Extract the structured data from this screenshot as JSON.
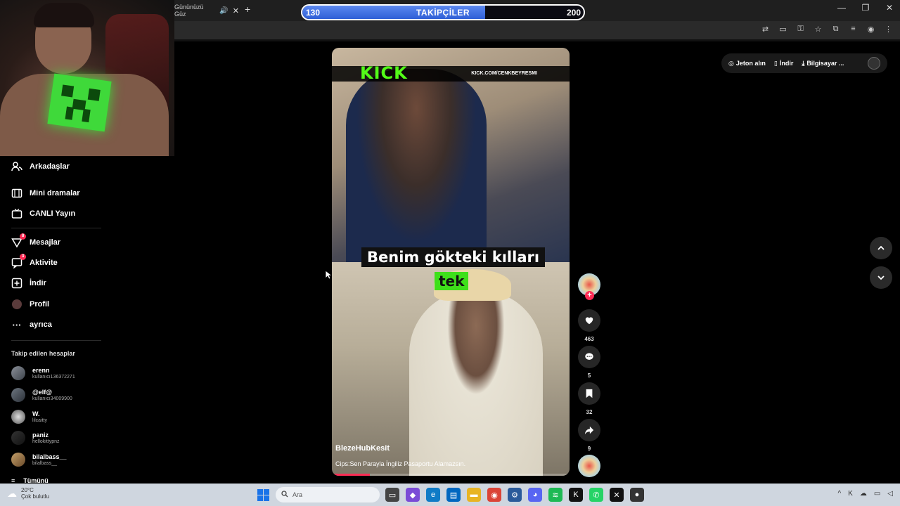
{
  "browser": {
    "tab_title": "Gününüzü Güz",
    "close_tab": "✕",
    "new_tab": "+",
    "window_controls": [
      "—",
      "❐",
      "✕"
    ],
    "toolbar_icons": [
      "translate-icon",
      "screen-icon",
      "key-icon",
      "star-icon",
      "extensions-icon",
      "media-icon",
      "profile-icon",
      "menu-icon"
    ]
  },
  "overlay": {
    "current": "130",
    "label": "TAKİPÇİLER",
    "goal": "200",
    "progress_fraction": 0.65
  },
  "sidebar": {
    "items": [
      {
        "label": "Arkadaşlar",
        "icon": "friends-icon",
        "glyph": "👥"
      },
      {
        "label": "Mini dramalar",
        "icon": "film-icon",
        "glyph": "▦"
      },
      {
        "label": "CANLI Yayın",
        "icon": "live-icon",
        "glyph": "▣"
      },
      {
        "label": "Mesajlar",
        "icon": "messages-icon",
        "glyph": "▽",
        "badge": "8"
      },
      {
        "label": "Aktivite",
        "icon": "activity-icon",
        "glyph": "▢",
        "badge": "3"
      },
      {
        "label": "İndir",
        "icon": "download-icon",
        "glyph": "⊞"
      },
      {
        "label": "Profil",
        "icon": "profile-icon",
        "glyph": "●"
      },
      {
        "label": "ayrıca",
        "icon": "more-icon",
        "glyph": "···"
      }
    ],
    "following_header": "Takip edilen hesaplar",
    "accounts": [
      {
        "name": "erenn",
        "handle": "kullanıcı136372271"
      },
      {
        "name": "@elf@",
        "handle": "kullanıcı34009900"
      },
      {
        "name": "W.",
        "handle": "lilcaitty"
      },
      {
        "name": "paniz",
        "handle": "hellokittypnz"
      },
      {
        "name": "bilalbass__",
        "handle": "bilalbass__"
      }
    ],
    "see_all": "Tümünü"
  },
  "video": {
    "kick_logo": "KICK",
    "kick_url": "KICK.COM/CENKBEYRESMI",
    "caption_line1": "Benim gökteki kılları",
    "caption_line2": "tek",
    "username": "BlezeHubKesit",
    "description": "Cips:Sen Parayla İngiliz Pasaportu Alamazsın.",
    "progress_fraction": 0.16
  },
  "actions": {
    "likes": "463",
    "comments": "5",
    "saves": "32",
    "shares": "9",
    "follow_plus": "+"
  },
  "top_actions": {
    "coins": "Jeton alın",
    "download": "İndir",
    "computer": "Bilgisayar ..."
  },
  "taskbar": {
    "temperature": "20°C",
    "weather": "Çok bulutlu",
    "search_placeholder": "Ara"
  },
  "colors": {
    "accent": "#fe2c55",
    "kick_green": "#53fc18",
    "progress_blue": "#2f5fd6"
  }
}
